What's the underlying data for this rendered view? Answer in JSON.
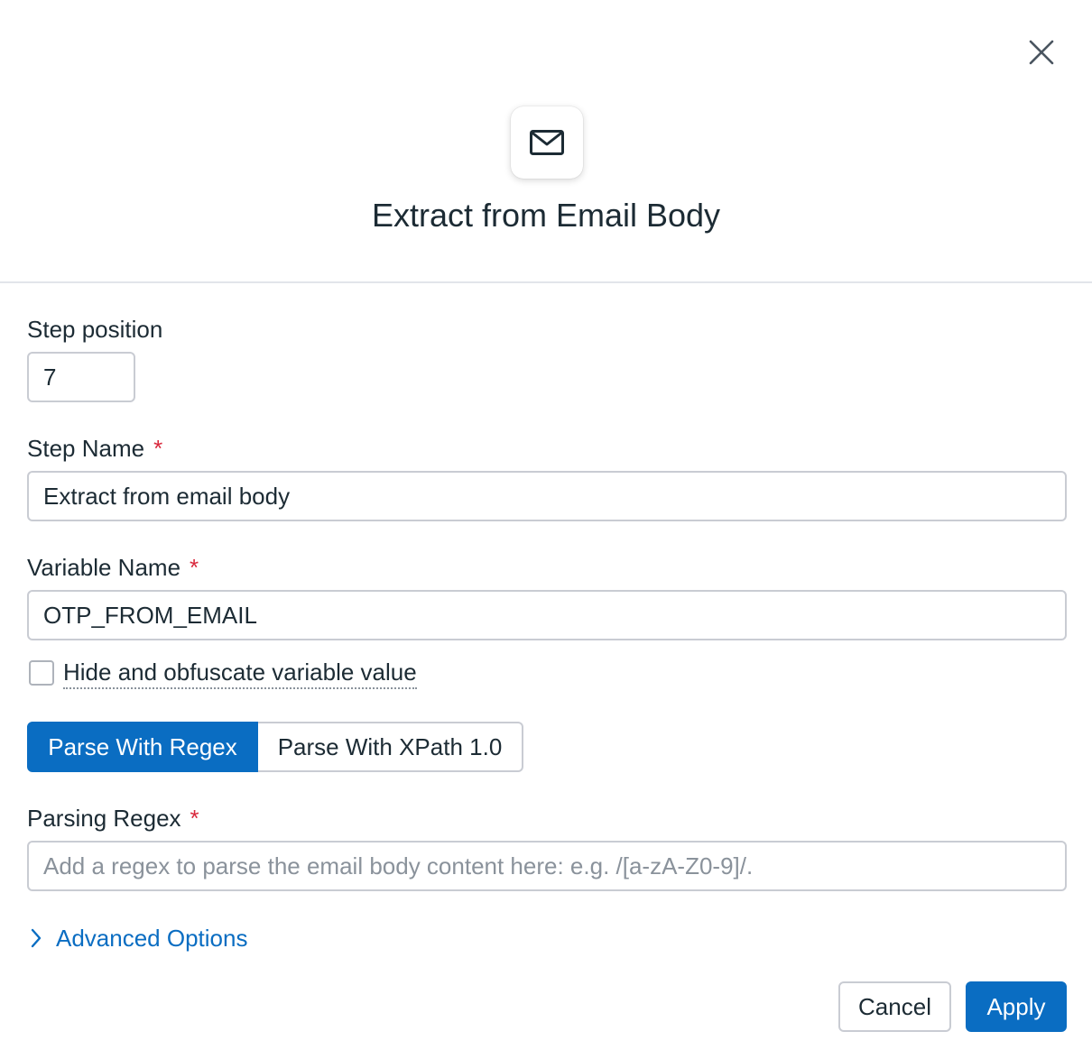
{
  "dialog": {
    "title": "Extract from Email Body",
    "header_icon": "envelope-icon",
    "close_icon": "close-icon"
  },
  "form": {
    "step_position": {
      "label": "Step position",
      "value": "7"
    },
    "step_name": {
      "label": "Step Name",
      "required_marker": "*",
      "value": "Extract from email body"
    },
    "variable_name": {
      "label": "Variable Name",
      "required_marker": "*",
      "value": "OTP_FROM_EMAIL"
    },
    "obfuscate": {
      "label": "Hide and obfuscate variable value",
      "checked": false
    },
    "parse_mode": {
      "options": [
        "Parse With Regex",
        "Parse With XPath 1.0"
      ],
      "selected": "Parse With Regex"
    },
    "parsing_regex": {
      "label": "Parsing Regex",
      "required_marker": "*",
      "value": "",
      "placeholder": "Add a regex to parse the email body content here: e.g. /[a-zA-Z0-9]/."
    },
    "advanced_options": {
      "label": "Advanced Options",
      "icon": "chevron-right-icon"
    }
  },
  "footer": {
    "cancel_label": "Cancel",
    "apply_label": "Apply"
  },
  "colors": {
    "accent": "#0a6dc2",
    "required": "#d9283c",
    "text": "#1c2b34",
    "border": "#c9ccd3"
  }
}
